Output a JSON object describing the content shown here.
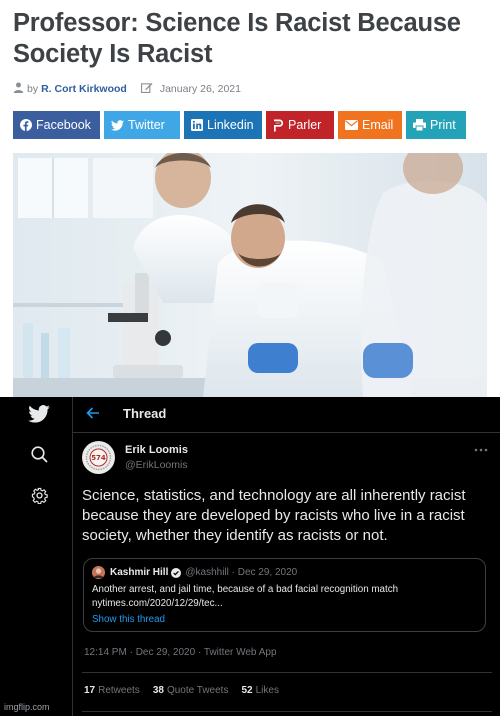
{
  "article": {
    "headline": "Professor: Science Is Racist Because Society Is Racist",
    "byline_by": "by",
    "author": "R. Cort Kirkwood",
    "date": "January 26, 2021",
    "share_buttons": [
      "Facebook",
      "Twitter",
      "Linkedin",
      "Parler",
      "Email",
      "Print"
    ]
  },
  "twitter": {
    "thread_title": "Thread",
    "author_name": "Erik Loomis",
    "author_handle": "@ErikLoomis",
    "tweet_text": "Science, statistics, and technology are all inherently racist because they are developed by racists who live in a racist society, whether they identify as racists or not.",
    "quote": {
      "name": "Kashmir Hill",
      "meta": "@kashhill · Dec 29, 2020",
      "text_line1": "Another arrest, and jail time, because of a bad facial recognition match",
      "text_line2": "nytimes.com/2020/12/29/tec...",
      "show_thread": "Show this thread"
    },
    "timestamp": "12:14 PM · Dec 29, 2020 · Twitter Web App",
    "stats": [
      {
        "count": "17",
        "label": "Retweets"
      },
      {
        "count": "38",
        "label": "Quote Tweets"
      },
      {
        "count": "52",
        "label": "Likes"
      }
    ],
    "avatar_text": "574"
  },
  "watermark": "imgflip.com",
  "colors": {
    "headline": "#3d4246",
    "author_link": "#2f5f9e",
    "facebook": "#3b5e9e",
    "twitter": "#40a7e7",
    "linkedin": "#1c73b6",
    "parler": "#c12428",
    "email": "#f07320",
    "print": "#24a3b8",
    "twitter_bg": "#000000",
    "twitter_link": "#1d9bf0"
  },
  "icons": [
    "user-icon",
    "edit-icon",
    "facebook-icon",
    "twitter-bird-icon",
    "linkedin-icon",
    "parler-icon",
    "envelope-icon",
    "printer-icon",
    "search-icon",
    "gear-icon",
    "back-arrow-icon",
    "more-icon",
    "verified-badge-icon"
  ]
}
